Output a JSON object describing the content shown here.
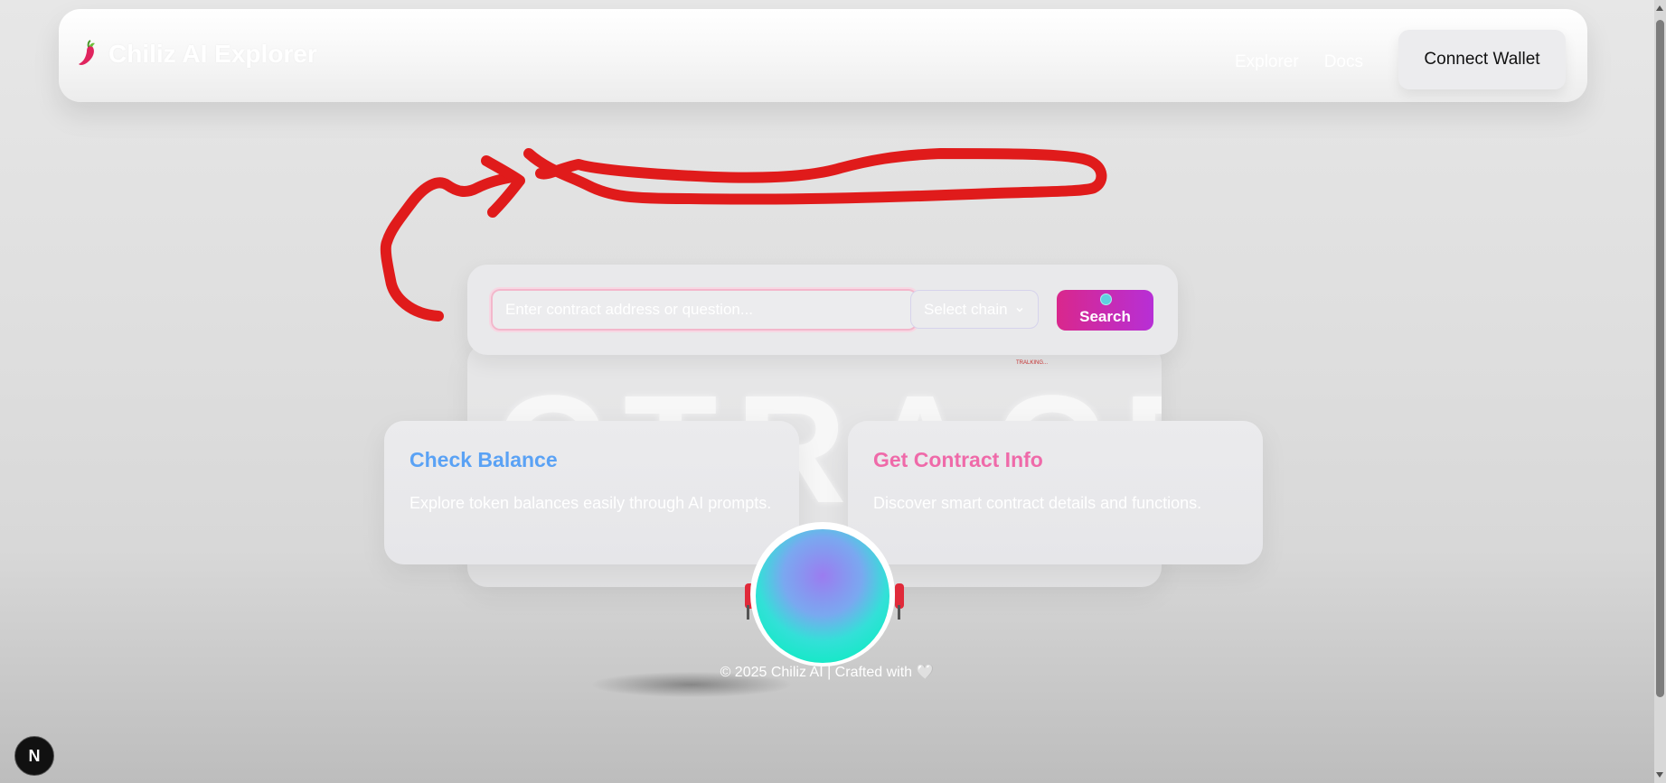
{
  "navbar": {
    "brand_title": "Chiliz AI Explorer",
    "links": [
      {
        "label": "Explorer"
      },
      {
        "label": "Docs"
      }
    ],
    "connect_label": "Connect Wallet"
  },
  "search": {
    "placeholder": "Enter contract address or question...",
    "chain_label": "Select chain",
    "button_label": "Search"
  },
  "background": {
    "word": "CTRACE",
    "tiny_label": "TRALKING..."
  },
  "cards": [
    {
      "title": "Check Balance",
      "description": "Explore token balances easily through AI prompts."
    },
    {
      "title": "Get Contract Info",
      "description": "Discover smart contract details and functions."
    }
  ],
  "footer": {
    "text": "© 2025 Chiliz AI | Crafted with 🤍"
  },
  "dev_badge": {
    "label": "N"
  },
  "colors": {
    "accent_pink": "#d9278c",
    "accent_purple": "#b72fd6",
    "blue_title": "#5aa2f5",
    "pink_title": "#ef6aa9",
    "annotation_red": "#e01b1b"
  }
}
